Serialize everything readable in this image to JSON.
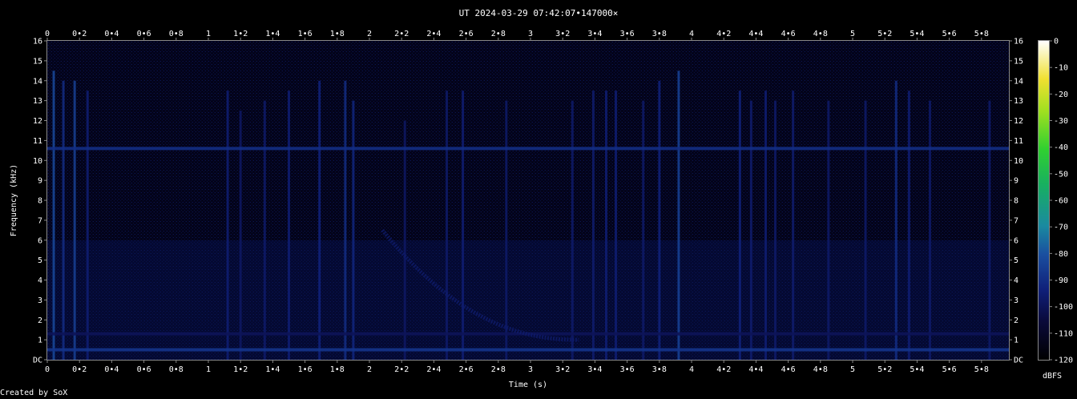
{
  "chart_data": {
    "type": "heatmap",
    "title": "UT 2024-03-29 07:42:07•147000×",
    "xlabel": "Time (s)",
    "ylabel": "Frequency (kHz)",
    "xlim": [
      0,
      5.97
    ],
    "ylim": [
      0,
      16
    ],
    "x_ticks": [
      "0",
      "0•2",
      "0•4",
      "0•6",
      "0•8",
      "1",
      "1•2",
      "1•4",
      "1•6",
      "1•8",
      "2",
      "2•2",
      "2•4",
      "2•6",
      "2•8",
      "3",
      "3•2",
      "3•4",
      "3•6",
      "3•8",
      "4",
      "4•2",
      "4•4",
      "4•6",
      "4•8",
      "5",
      "5•2",
      "5•4",
      "5•6",
      "5•8"
    ],
    "x_tick_values": [
      0,
      0.2,
      0.4,
      0.6,
      0.8,
      1,
      1.2,
      1.4,
      1.6,
      1.8,
      2,
      2.2,
      2.4,
      2.6,
      2.8,
      3,
      3.2,
      3.4,
      3.6,
      3.8,
      4,
      4.2,
      4.4,
      4.6,
      4.8,
      5,
      5.2,
      5.4,
      5.6,
      5.8
    ],
    "y_ticks": [
      "DC",
      "1",
      "2",
      "3",
      "4",
      "5",
      "6",
      "7",
      "8",
      "9",
      "10",
      "11",
      "12",
      "13",
      "14",
      "15",
      "16"
    ],
    "y_tick_values": [
      0,
      1,
      2,
      3,
      4,
      5,
      6,
      7,
      8,
      9,
      10,
      11,
      12,
      13,
      14,
      15,
      16
    ],
    "colorbar": {
      "label": "dBFS",
      "range": [
        -120,
        0
      ],
      "ticks": [
        "0",
        "-10",
        "-20",
        "-30",
        "-40",
        "-50",
        "-60",
        "-70",
        "-80",
        "-90",
        "-100",
        "-110",
        "-120"
      ],
      "tick_values": [
        0,
        -10,
        -20,
        -30,
        -40,
        -50,
        -60,
        -70,
        -80,
        -90,
        -100,
        -110,
        -120
      ]
    },
    "background_level_dbfs": -105,
    "horizontal_bands": [
      {
        "freq_khz": 10.6,
        "level_dbfs": -90
      },
      {
        "freq_khz": 0.5,
        "level_dbfs": -88
      },
      {
        "freq_khz": 1.3,
        "level_dbfs": -100
      }
    ],
    "impulses": [
      {
        "t": 0.04,
        "top_khz": 14.5,
        "level_dbfs": -82
      },
      {
        "t": 0.1,
        "top_khz": 14,
        "level_dbfs": -90
      },
      {
        "t": 0.17,
        "top_khz": 14,
        "level_dbfs": -85
      },
      {
        "t": 0.25,
        "top_khz": 13.5,
        "level_dbfs": -95
      },
      {
        "t": 1.12,
        "top_khz": 13.5,
        "level_dbfs": -95
      },
      {
        "t": 1.2,
        "top_khz": 12.5,
        "level_dbfs": -98
      },
      {
        "t": 1.35,
        "top_khz": 13,
        "level_dbfs": -97
      },
      {
        "t": 1.5,
        "top_khz": 13.5,
        "level_dbfs": -95
      },
      {
        "t": 1.69,
        "top_khz": 14,
        "level_dbfs": -93
      },
      {
        "t": 1.85,
        "top_khz": 14,
        "level_dbfs": -90
      },
      {
        "t": 1.9,
        "top_khz": 13,
        "level_dbfs": -92
      },
      {
        "t": 2.22,
        "top_khz": 12,
        "level_dbfs": -98
      },
      {
        "t": 2.48,
        "top_khz": 13.5,
        "level_dbfs": -97
      },
      {
        "t": 2.58,
        "top_khz": 13.5,
        "level_dbfs": -95
      },
      {
        "t": 2.85,
        "top_khz": 13,
        "level_dbfs": -97
      },
      {
        "t": 3.26,
        "top_khz": 13,
        "level_dbfs": -97
      },
      {
        "t": 3.39,
        "top_khz": 13.5,
        "level_dbfs": -96
      },
      {
        "t": 3.47,
        "top_khz": 13.5,
        "level_dbfs": -95
      },
      {
        "t": 3.53,
        "top_khz": 13.5,
        "level_dbfs": -95
      },
      {
        "t": 3.7,
        "top_khz": 13,
        "level_dbfs": -97
      },
      {
        "t": 3.8,
        "top_khz": 14,
        "level_dbfs": -93
      },
      {
        "t": 3.92,
        "top_khz": 14.5,
        "level_dbfs": -84
      },
      {
        "t": 4.3,
        "top_khz": 13.5,
        "level_dbfs": -93
      },
      {
        "t": 4.37,
        "top_khz": 13,
        "level_dbfs": -96
      },
      {
        "t": 4.46,
        "top_khz": 13.5,
        "level_dbfs": -95
      },
      {
        "t": 4.52,
        "top_khz": 13,
        "level_dbfs": -97
      },
      {
        "t": 4.63,
        "top_khz": 13.5,
        "level_dbfs": -96
      },
      {
        "t": 4.85,
        "top_khz": 13,
        "level_dbfs": -97
      },
      {
        "t": 5.08,
        "top_khz": 13,
        "level_dbfs": -97
      },
      {
        "t": 5.27,
        "top_khz": 14,
        "level_dbfs": -90
      },
      {
        "t": 5.35,
        "top_khz": 13.5,
        "level_dbfs": -95
      },
      {
        "t": 5.48,
        "top_khz": 13,
        "level_dbfs": -97
      },
      {
        "t": 5.85,
        "top_khz": 13,
        "level_dbfs": -97
      }
    ],
    "whistler": {
      "start_t": 2.08,
      "start_khz": 6.5,
      "end_t": 3.3,
      "end_khz": 1.0,
      "level_dbfs": -96
    },
    "credit": "Created by SoX"
  }
}
